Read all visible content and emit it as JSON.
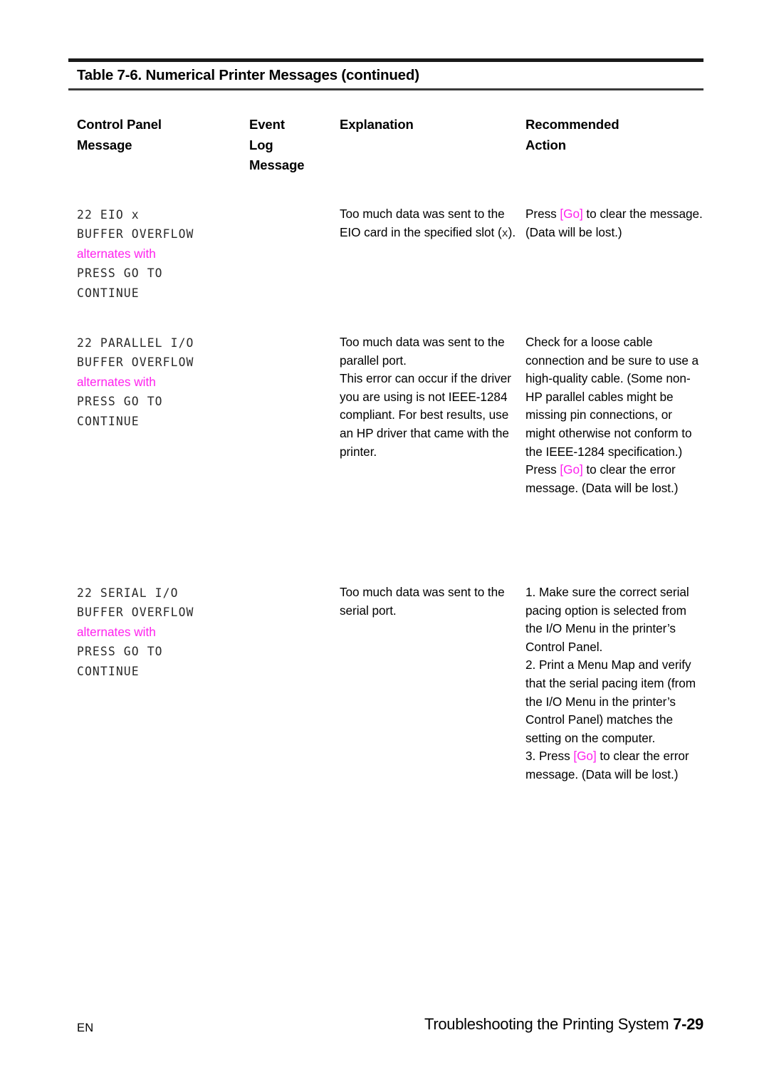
{
  "document": {
    "table_caption": "Table 7-6. Numerical Printer Messages (continued)",
    "accent_color": "#ff22ee",
    "text_color": "#000000"
  },
  "columns": {
    "control_panel_message": [
      "Control Panel",
      "Message"
    ],
    "event_log_message": [
      "Event",
      "Log",
      "Message"
    ],
    "explanation": [
      "Explanation"
    ],
    "recommended_action": [
      "Recommended",
      "Action"
    ]
  },
  "rows": [
    {
      "control_panel_message": {
        "line1": "22 EIO ",
        "line1_suffix": "x",
        "line2": "BUFFER OVERFLOW",
        "alternates_label": "alternates with",
        "line3": "PRESS GO TO",
        "line4": "CONTINUE"
      },
      "event_log_message": "",
      "explanation": {
        "part1": "Too much data was sent to the EIO card in the specified slot (",
        "glyph": "x",
        "part2": ")."
      },
      "recommended_action": {
        "pre": "Press ",
        "key": "[Go]",
        "post": " to clear the message. (Data will be lost.)"
      }
    },
    {
      "control_panel_message": {
        "line1": "22 PARALLEL I/O",
        "line2": "BUFFER OVERFLOW",
        "alternates_label": "alternates with",
        "line3": "PRESS GO TO",
        "line4": "CONTINUE"
      },
      "event_log_message": "",
      "explanation": {
        "para1": "Too much data was sent to the parallel port.",
        "para2": "This error can occur if the driver you are using is not IEEE-1284 compliant. For best results, use an HP driver that came with the printer."
      },
      "recommended_action": {
        "para1": "Check for a loose cable connection and be sure to use a high-quality cable. (Some non-HP parallel cables might be missing pin connections, or might otherwise not conform to the IEEE-1284 specification.)",
        "pre": "Press ",
        "key": "[Go]",
        "post": " to clear the error message. (Data will be lost.)"
      }
    },
    {
      "control_panel_message": {
        "line1": "22 SERIAL I/O",
        "line2": "BUFFER OVERFLOW",
        "alternates_label": "alternates with",
        "line3": "PRESS GO TO",
        "line4": "CONTINUE"
      },
      "event_log_message": "",
      "explanation": {
        "para1": "Too much data was sent to the serial port."
      },
      "recommended_action": {
        "item1": "1. Make sure the correct serial pacing option is selected from the I/O Menu in the printer’s Control Panel.",
        "item2": "2. Print a Menu Map and verify that the serial pacing item (from the I/O Menu in the printer’s Control Panel) matches the setting on the computer.",
        "item3_pre": "3. Press ",
        "item3_key": "[Go]",
        "item3_post": " to clear the error message. (Data will be lost.)"
      }
    }
  ],
  "footer": {
    "language": "EN",
    "running_title": "Troubleshooting the Printing System ",
    "page_number": "7-29"
  }
}
